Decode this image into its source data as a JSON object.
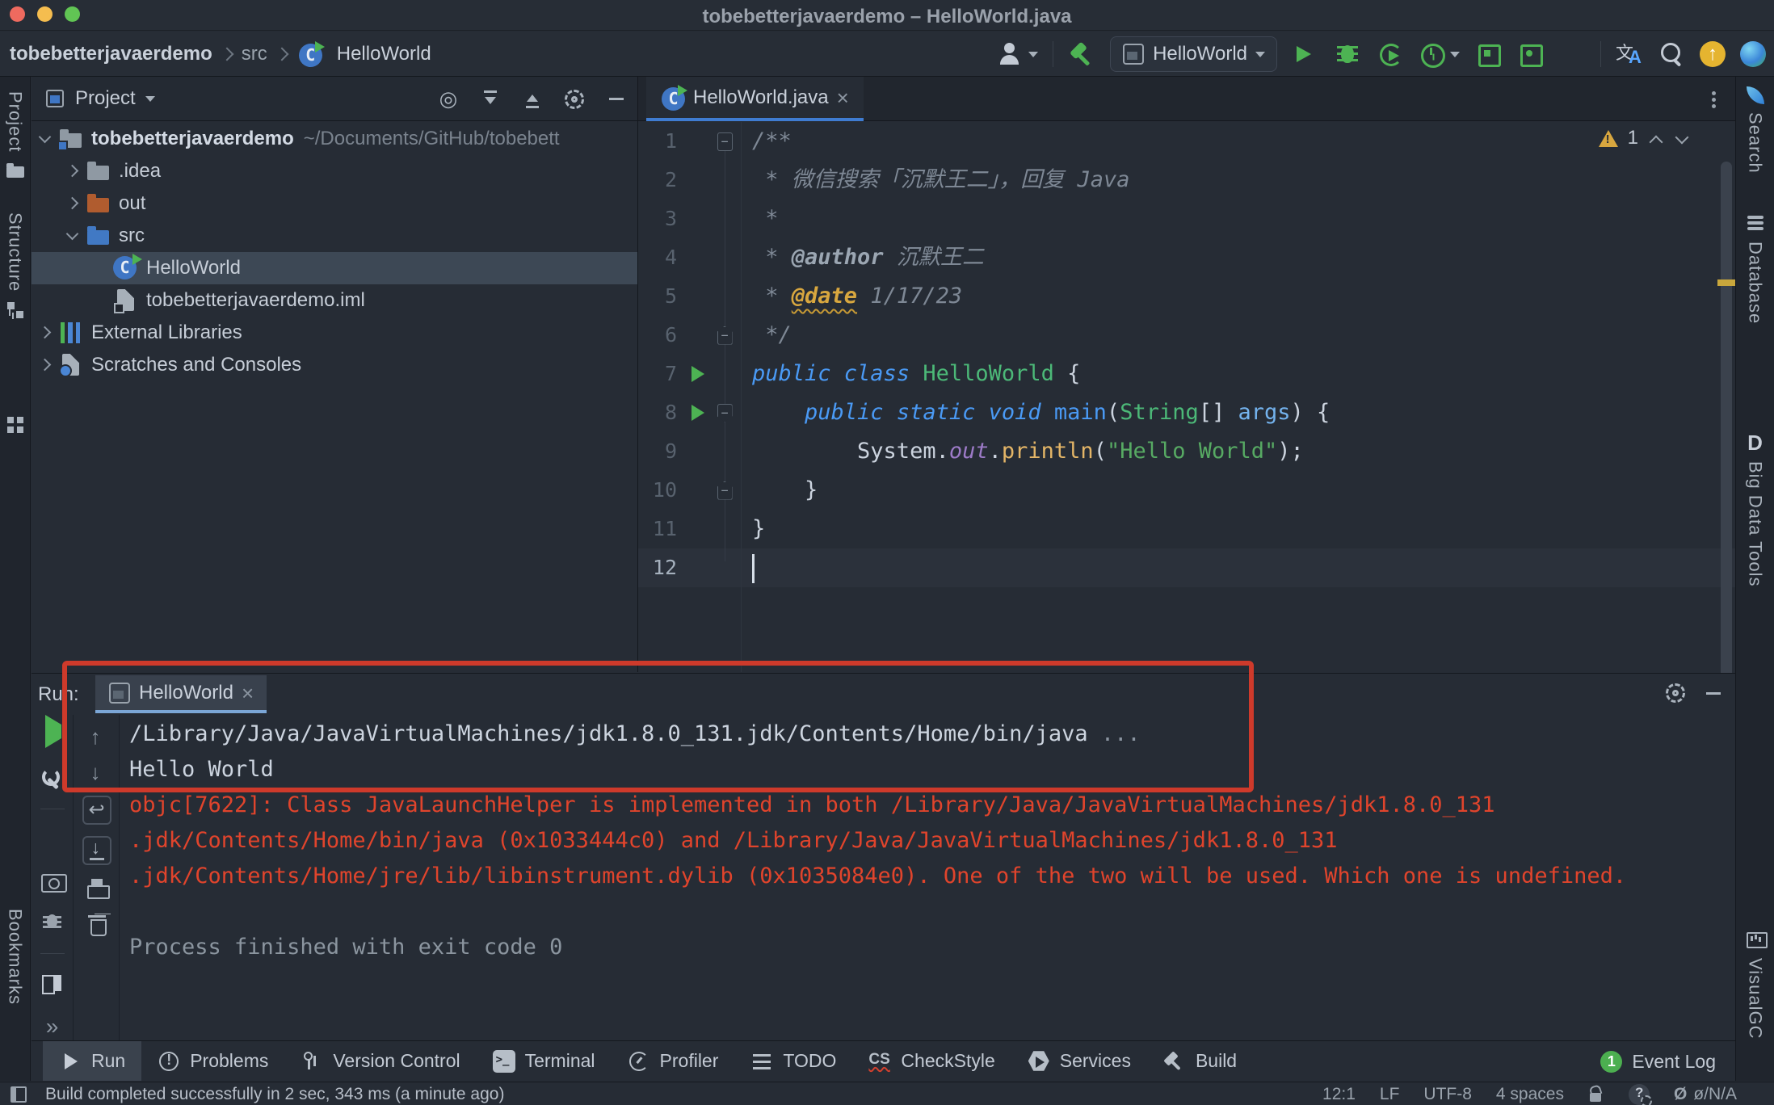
{
  "window": {
    "title": "tobebetterjavaerdemo – HelloWorld.java"
  },
  "breadcrumbs": {
    "items": [
      "tobebetterjavaerdemo",
      "src",
      "HelloWorld"
    ]
  },
  "toolbar": {
    "run_config": "HelloWorld"
  },
  "left_stripe": {
    "project": "Project",
    "structure": "Structure",
    "bookmarks": "Bookmarks",
    "more": "»"
  },
  "right_stripe": {
    "search": "Search",
    "database": "Database",
    "big_data": "Big Data Tools",
    "visualgc": "VisualGC"
  },
  "project": {
    "header": "Project",
    "tree": [
      {
        "label": "tobebetterjavaerdemo",
        "hint": "~/Documents/GitHub/tobebett",
        "icon": "project-folder",
        "chevron": "v",
        "indent": 0,
        "bold": true
      },
      {
        "label": ".idea",
        "icon": "folder",
        "chevron": ">",
        "indent": 1
      },
      {
        "label": "out",
        "icon": "folder-excluded",
        "chevron": ">",
        "indent": 1
      },
      {
        "label": "src",
        "icon": "folder-src",
        "chevron": "v",
        "indent": 1
      },
      {
        "label": "HelloWorld",
        "icon": "class-run",
        "indent": 2,
        "selected": true
      },
      {
        "label": "tobebetterjavaerdemo.iml",
        "icon": "file-iml",
        "indent": 2
      },
      {
        "label": "External Libraries",
        "icon": "libraries",
        "chevron": ">",
        "indent": 0
      },
      {
        "label": "Scratches and Consoles",
        "icon": "scratches",
        "chevron": ">",
        "indent": 0
      }
    ]
  },
  "editor": {
    "tab": "HelloWorld.java",
    "warning_count": "1",
    "lines": [
      {
        "n": "1",
        "fold": "box",
        "tokens": [
          {
            "t": "/**",
            "c": "cmt"
          }
        ]
      },
      {
        "n": "2",
        "tokens": [
          {
            "t": " * 微信搜索「沉默王二」，回复 Java",
            "c": "cmt"
          }
        ]
      },
      {
        "n": "3",
        "tokens": [
          {
            "t": " *",
            "c": "cmt"
          }
        ]
      },
      {
        "n": "4",
        "tokens": [
          {
            "t": " * ",
            "c": "cmt"
          },
          {
            "t": "@author",
            "c": "tag"
          },
          {
            "t": " 沉默王二",
            "c": "cmt"
          }
        ]
      },
      {
        "n": "5",
        "tokens": [
          {
            "t": " * ",
            "c": "cmt"
          },
          {
            "t": "@date",
            "c": "tagwarn"
          },
          {
            "t": " 1/17/23",
            "c": "cmt"
          }
        ]
      },
      {
        "n": "6",
        "fold": "up",
        "tokens": [
          {
            "t": " */",
            "c": "cmt"
          }
        ]
      },
      {
        "n": "7",
        "run": true,
        "tokens": [
          {
            "t": "public class ",
            "c": "kw"
          },
          {
            "t": "HelloWorld ",
            "c": "cls"
          },
          {
            "t": "{",
            "c": "pln"
          }
        ]
      },
      {
        "n": "8",
        "run": true,
        "fold": "down",
        "tokens": [
          {
            "t": "    ",
            "c": "pln"
          },
          {
            "t": "public static void ",
            "c": "kw"
          },
          {
            "t": "main",
            "c": "mth"
          },
          {
            "t": "(",
            "c": "pln"
          },
          {
            "t": "String",
            "c": "cls"
          },
          {
            "t": "[] ",
            "c": "pln"
          },
          {
            "t": "args",
            "c": "arg"
          },
          {
            "t": ") {",
            "c": "pln"
          }
        ]
      },
      {
        "n": "9",
        "tokens": [
          {
            "t": "        System.",
            "c": "pln"
          },
          {
            "t": "out",
            "c": "fld"
          },
          {
            "t": ".",
            "c": "pln"
          },
          {
            "t": "println",
            "c": "mthc"
          },
          {
            "t": "(",
            "c": "pln"
          },
          {
            "t": "\"Hello World\"",
            "c": "str"
          },
          {
            "t": ");",
            "c": "pln"
          }
        ]
      },
      {
        "n": "10",
        "fold": "up",
        "tokens": [
          {
            "t": "    }",
            "c": "pln"
          }
        ]
      },
      {
        "n": "11",
        "tokens": [
          {
            "t": "}",
            "c": "pln"
          }
        ]
      },
      {
        "n": "12",
        "current": true,
        "caret": true,
        "tokens": []
      }
    ]
  },
  "run_panel": {
    "label": "Run:",
    "tab": "HelloWorld",
    "output": [
      {
        "text": "/Library/Java/JavaVirtualMachines/jdk1.8.0_131.jdk/Contents/Home/bin/java",
        "c": "plain",
        "suffix": " ..."
      },
      {
        "text": "Hello World",
        "c": "plain"
      },
      {
        "text": "objc[7622]: Class JavaLaunchHelper is implemented in both /Library/Java/JavaVirtualMachines/jdk1.8.0_131",
        "c": "err"
      },
      {
        "text": ".jdk/Contents/Home/bin/java (0x1033444c0) and /Library/Java/JavaVirtualMachines/jdk1.8.0_131",
        "c": "err"
      },
      {
        "text": ".jdk/Contents/Home/jre/lib/libinstrument.dylib (0x1035084e0). One of the two will be used. Which one is undefined.",
        "c": "err"
      },
      {
        "text": "",
        "c": "plain"
      },
      {
        "text": "Process finished with exit code 0",
        "c": "sys"
      }
    ]
  },
  "bottom_bar": {
    "items": [
      {
        "label": "Run",
        "icon": "run",
        "selected": true
      },
      {
        "label": "Problems",
        "icon": "problems"
      },
      {
        "label": "Version Control",
        "icon": "vcs"
      },
      {
        "label": "Terminal",
        "icon": "terminal"
      },
      {
        "label": "Profiler",
        "icon": "profiler"
      },
      {
        "label": "TODO",
        "icon": "todo"
      },
      {
        "label": "CheckStyle",
        "icon": "checkstyle"
      },
      {
        "label": "Services",
        "icon": "services"
      },
      {
        "label": "Build",
        "icon": "build"
      }
    ],
    "event_log": {
      "badge": "1",
      "label": "Event Log"
    }
  },
  "status_bar": {
    "message": "Build completed successfully in 2 sec, 343 ms (a minute ago)",
    "caret_position": "12:1",
    "line_ending": "LF",
    "encoding": "UTF-8",
    "indent": "4 spaces",
    "memory": "ø/N/A"
  },
  "colors": {
    "accent_blue": "#3f7cd1",
    "run_green": "#4db353",
    "error_red": "#e0442c",
    "warning_yellow": "#d8a73f",
    "annotation_red": "#ce3a2b",
    "selection": "#3d4855"
  }
}
